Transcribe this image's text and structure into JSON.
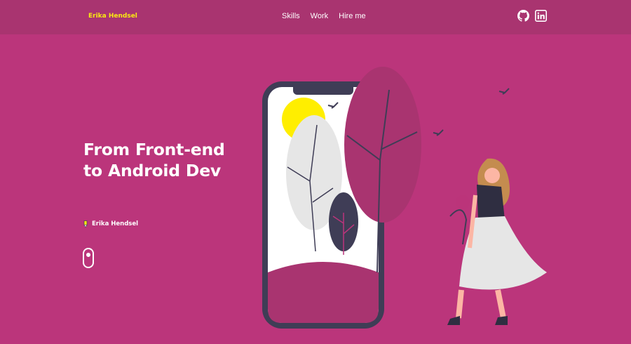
{
  "nav": {
    "brand": "Erika Hendsel",
    "links": [
      "Skills",
      "Work",
      "Hire me"
    ],
    "social": {
      "github_icon": "github-icon",
      "linkedin_icon": "linkedin-icon"
    }
  },
  "hero": {
    "title": "From Front-end to Android Dev",
    "author": "Erika Hendsel",
    "author_icon": "pencil-icon",
    "scroll_icon": "mouse-scroll-icon"
  },
  "colors": {
    "background": "#bb357b",
    "navbar": "#a93470",
    "brand": "#f9ea12",
    "text": "#ffffff",
    "phone_frame": "#3f3d56",
    "sun": "#ffee00"
  }
}
